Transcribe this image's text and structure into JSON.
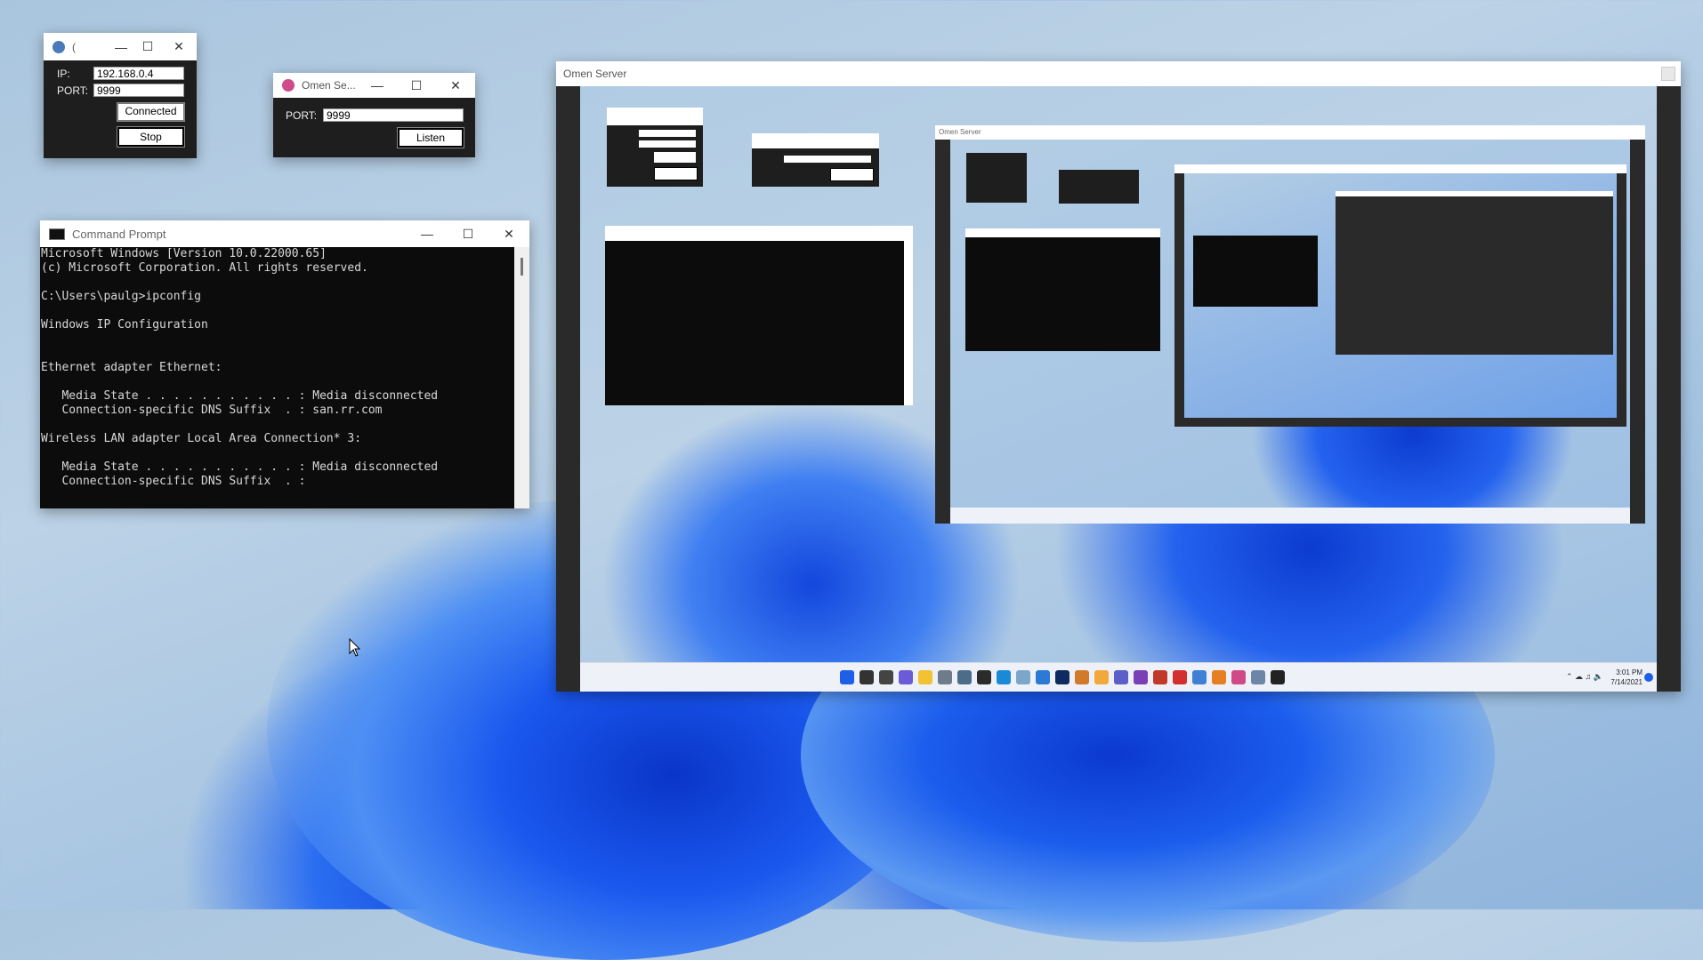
{
  "colors": {
    "accent_blue": "#1f5fe8",
    "console_bg": "#0c0c0c",
    "console_fg": "#d8d8d8",
    "omen_icon": "#d04a8a"
  },
  "client_window": {
    "title": "(",
    "ip_label": "IP:",
    "ip_value": "192.168.0.4",
    "port_label": "PORT:",
    "port_value": "9999",
    "connected_label": "Connected",
    "stop_label": "Stop"
  },
  "server_small_window": {
    "title": "Omen Se...",
    "port_label": "PORT:",
    "port_value": "9999",
    "listen_label": "Listen"
  },
  "cmd_window": {
    "title": "Command Prompt",
    "lines": [
      "Microsoft Windows [Version 10.0.22000.65]",
      "(c) Microsoft Corporation. All rights reserved.",
      "",
      "C:\\Users\\paulg>ipconfig",
      "",
      "Windows IP Configuration",
      "",
      "",
      "Ethernet adapter Ethernet:",
      "",
      "   Media State . . . . . . . . . . . : Media disconnected",
      "   Connection-specific DNS Suffix  . : san.rr.com",
      "",
      "Wireless LAN adapter Local Area Connection* 3:",
      "",
      "   Media State . . . . . . . . . . . : Media disconnected",
      "   Connection-specific DNS Suffix  . :"
    ]
  },
  "omen_server_window": {
    "title": "Omen Server",
    "inner_title": "Omen Server",
    "taskbar_time": "3:01 PM",
    "taskbar_date": "7/14/2021",
    "taskbar_icons": [
      "start-icon",
      "search-icon",
      "task-view-icon",
      "chat-icon",
      "file-explorer-icon",
      "settings-icon",
      "calculator-icon",
      "terminal-icon",
      "edge-icon",
      "photos-icon",
      "notepad-icon",
      "photoshop-icon",
      "app-icon",
      "weather-icon",
      "teams-icon",
      "visual-studio-icon",
      "app-icon",
      "record-icon",
      "paint-icon",
      "app-icon",
      "omen-icon",
      "app-icon",
      "console-icon"
    ]
  }
}
